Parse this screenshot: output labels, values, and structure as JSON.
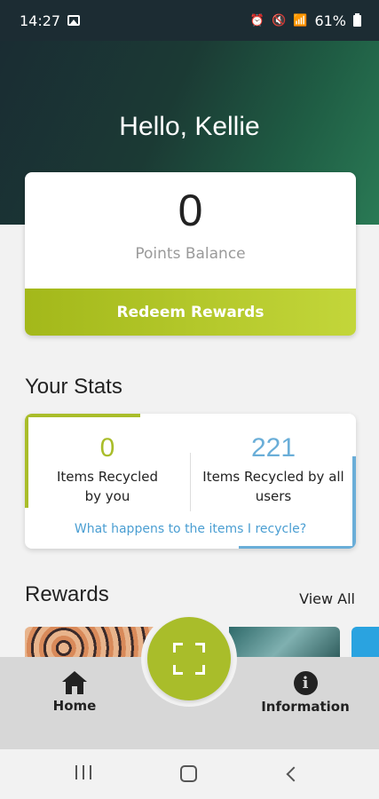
{
  "status_bar": {
    "time": "14:27",
    "battery": "61%"
  },
  "header": {
    "greeting": "Hello, Kellie"
  },
  "points": {
    "value": "0",
    "label": "Points Balance",
    "redeem_label": "Redeem Rewards"
  },
  "stats": {
    "title": "Your Stats",
    "you_value": "0",
    "you_label": "Items Recycled by you",
    "all_value": "221",
    "all_label": "Items Recycled by all users",
    "link": "What happens to the items I recycle?"
  },
  "rewards": {
    "title": "Rewards",
    "view_all": "View All"
  },
  "bottom_nav": {
    "home": "Home",
    "information": "Information"
  },
  "colors": {
    "accent_green": "#a9bd2a",
    "accent_blue": "#6aaed8",
    "header_dark": "#1c2c33"
  }
}
